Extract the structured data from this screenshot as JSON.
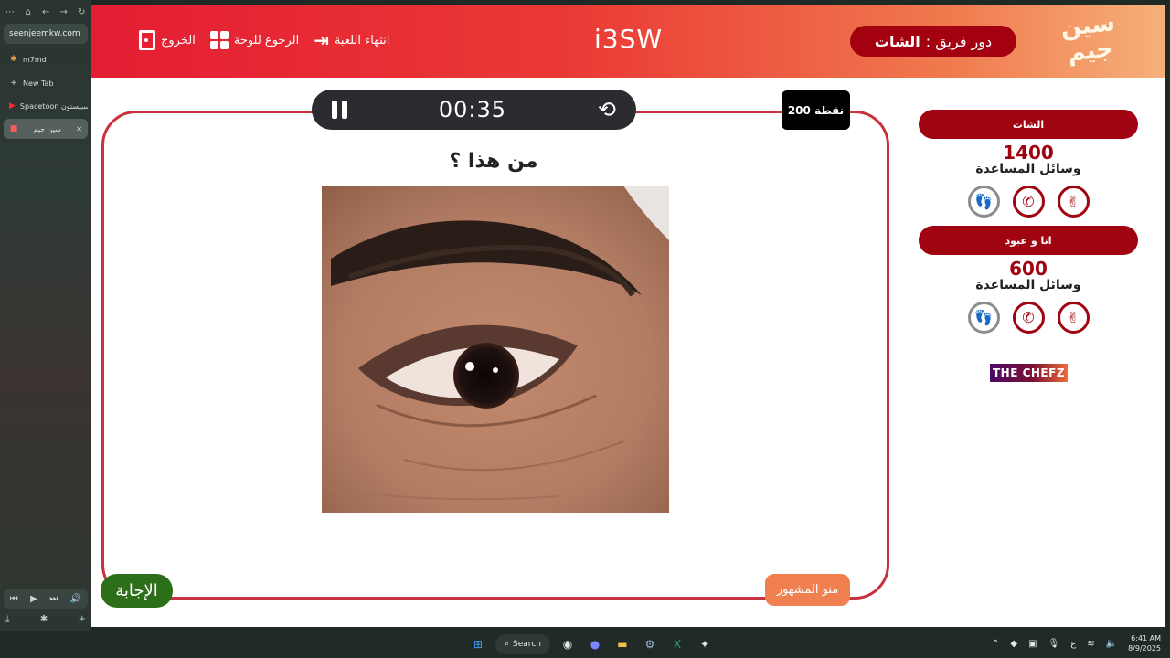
{
  "browser": {
    "nav_icons": [
      "more-icon",
      "home-icon",
      "back-icon",
      "forward-icon",
      "reload-icon"
    ],
    "url": "seenjeemkw.com",
    "tabs": [
      {
        "label": "m7md",
        "icon": "bookmark-icon"
      },
      {
        "label": "New Tab",
        "icon": "plus-icon"
      },
      {
        "label": "Spacetoon سبيستون",
        "icon": "youtube-icon"
      },
      {
        "label": "سين جيم",
        "icon": "seenjeem-icon",
        "active": true
      }
    ]
  },
  "header": {
    "title": "i3SW",
    "links": {
      "exit": "الخروج",
      "back_to_board": "الرجوع للوحة",
      "end_game": "انتهاء اللعبة"
    },
    "turn_label": "دور فريق :",
    "turn_team": "الشات",
    "logo_text": "سين جيم"
  },
  "question": {
    "timer": "00:35",
    "points": "200 نقطة",
    "text": "من هذا ؟",
    "category": "منو المشهور",
    "answer_button": "الإجابة",
    "image": "close-up-eye-photo"
  },
  "teams": [
    {
      "name": "الشات",
      "score": "1400",
      "aids_label": "وسائل المساعدة",
      "aids": [
        {
          "icon": "peace-hand-icon",
          "used": false
        },
        {
          "icon": "phone-icon",
          "used": false
        },
        {
          "icon": "footsteps-icon",
          "used": true
        }
      ]
    },
    {
      "name": "انا و عبود",
      "score": "600",
      "aids_label": "وسائل المساعدة",
      "aids": [
        {
          "icon": "peace-hand-icon",
          "used": false
        },
        {
          "icon": "phone-icon",
          "used": false
        },
        {
          "icon": "footsteps-icon",
          "used": true
        }
      ]
    }
  ],
  "sponsor": "THE CHEFZ",
  "taskbar": {
    "search": "Search",
    "time": "6:41 AM",
    "date": "8/9/2025",
    "lang": "ع"
  },
  "colors": {
    "primary_red": "#a00410",
    "header_start": "#e41d33",
    "header_end": "#f6b079",
    "answer_green": "#2d6f18",
    "category_orange": "#f0804f"
  }
}
